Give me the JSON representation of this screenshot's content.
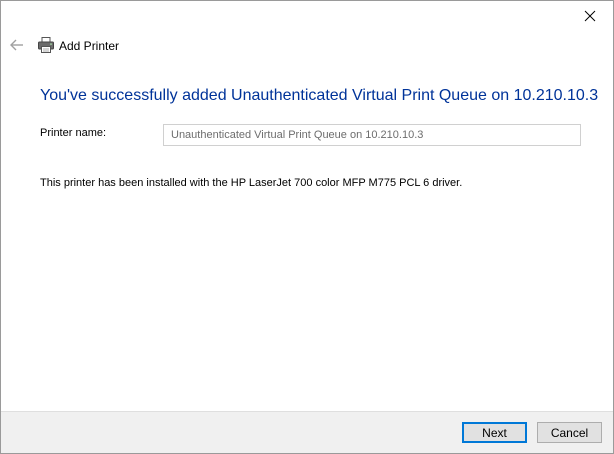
{
  "window": {
    "title": "Add Printer"
  },
  "main": {
    "heading": "You've successfully added Unauthenticated Virtual Print Queue on 10.210.10.3",
    "printer_name_label": "Printer name:",
    "printer_name_value": "Unauthenticated Virtual Print Queue on 10.210.10.3",
    "driver_info": "This printer has been installed with the HP LaserJet 700 color MFP M775 PCL 6 driver."
  },
  "footer": {
    "next_label": "Next",
    "cancel_label": "Cancel"
  },
  "colors": {
    "heading": "#003399",
    "primary_border": "#0078d7",
    "footer_bg": "#f0f0f0"
  },
  "icons": {
    "close": "close-icon",
    "back": "back-arrow-icon",
    "printer": "printer-icon"
  }
}
